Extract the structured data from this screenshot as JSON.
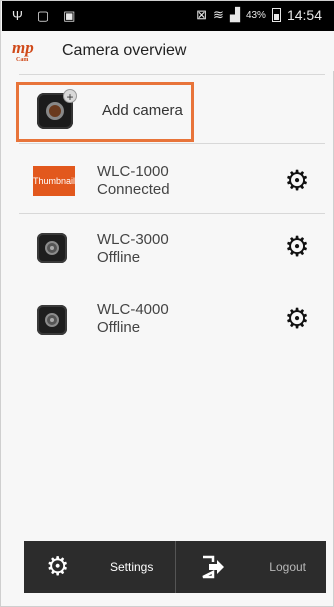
{
  "status_bar": {
    "battery_percent": "43%",
    "time": "14:54",
    "left_icons": [
      "usb-icon",
      "download-icon",
      "notification-icon"
    ],
    "right_icons": [
      "mute-icon",
      "wifi-icon",
      "signal-icon",
      "battery-icon"
    ]
  },
  "header": {
    "logo_text": "mp",
    "logo_subtext": "Cam",
    "title": "Camera overview"
  },
  "add_camera": {
    "label": "Add camera",
    "highlight_color": "#e8743a"
  },
  "cameras": [
    {
      "name": "WLC-1000",
      "status": "Connected",
      "thumbnail": "Thumbnail"
    },
    {
      "name": "WLC-3000",
      "status": "Offline"
    },
    {
      "name": "WLC-4000",
      "status": "Offline"
    }
  ],
  "bottom_bar": {
    "settings_label": "Settings",
    "logout_label": "Logout"
  },
  "colors": {
    "accent": "#e2581d",
    "bar_bg": "#2c2c2c"
  }
}
